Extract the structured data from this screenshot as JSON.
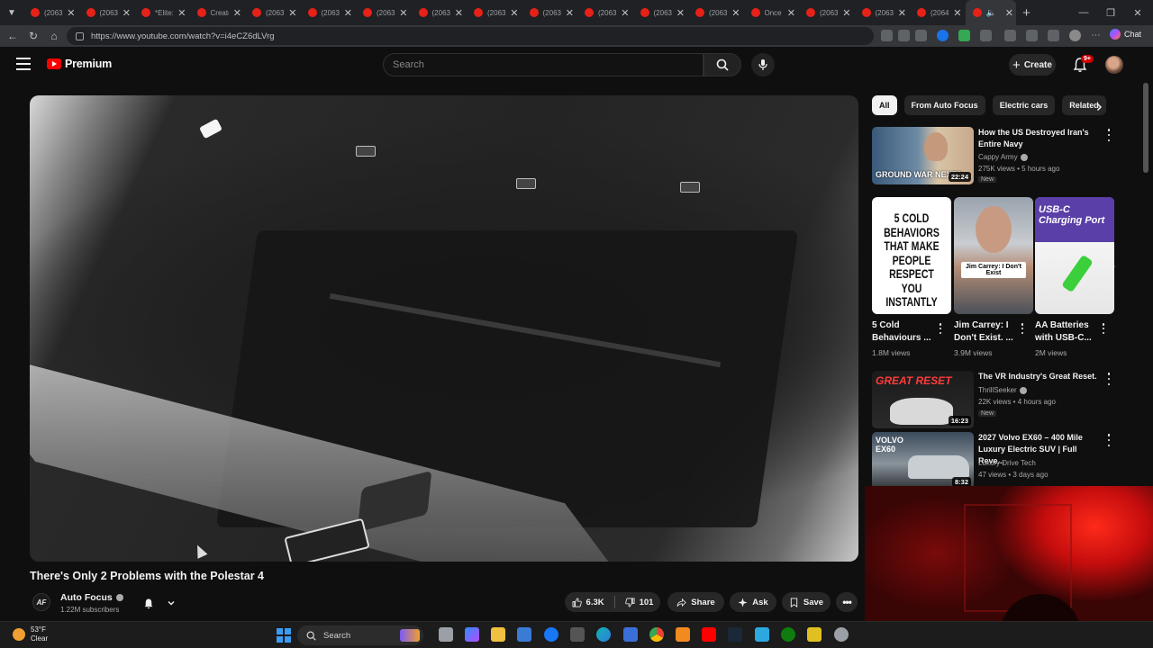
{
  "browser": {
    "tabs": [
      {
        "title": "(2063)"
      },
      {
        "title": "(2063)"
      },
      {
        "title": "*Elite:"
      },
      {
        "title": "Create"
      },
      {
        "title": "(2063)"
      },
      {
        "title": "(2063)"
      },
      {
        "title": "(2063)"
      },
      {
        "title": "(2063)"
      },
      {
        "title": "(2063)"
      },
      {
        "title": "(2063)"
      },
      {
        "title": "(2063)"
      },
      {
        "title": "(2063)"
      },
      {
        "title": "(2063)"
      },
      {
        "title": "Once"
      },
      {
        "title": "(2063)"
      },
      {
        "title": "(2063)"
      },
      {
        "title": "(2064)"
      }
    ],
    "active_tab": {
      "title": "(2"
    },
    "url": "https://www.youtube.com/watch?v=i4eCZ6dLVrg",
    "chat_label": "Chat"
  },
  "header": {
    "brand": "Premium",
    "search_placeholder": "Search",
    "create_label": "Create",
    "notification_count": "9+"
  },
  "video": {
    "title": "There's Only 2 Problems with the Polestar 4",
    "channel": "Auto Focus",
    "channel_initials": "AF",
    "subscribers": "1.22M subscribers",
    "likes": "6.3K",
    "dislikes": "101",
    "share_label": "Share",
    "ask_label": "Ask",
    "save_label": "Save"
  },
  "chips": [
    "All",
    "From Auto Focus",
    "Electric cars",
    "Related"
  ],
  "recommendations": [
    {
      "title": "How the US Destroyed Iran's Entire Navy",
      "channel": "Cappy Army",
      "meta": "275K views • 5 hours ago",
      "badge": "New",
      "duration": "22:24",
      "thumb_text": "GROUND WAR NEXT?"
    },
    {
      "title": "The VR Industry's Great Reset.",
      "channel": "ThrillSeeker",
      "meta": "22K views • 4 hours ago",
      "badge": "New",
      "duration": "16:23",
      "thumb_text": "GREAT RESET"
    },
    {
      "title": "2027 Volvo EX60 – 400 Mile Luxury Electric SUV | Full Reve...",
      "channel": "Luxury Drive Tech",
      "meta": "47 views • 3 days ago",
      "badge": "",
      "duration": "8:32",
      "thumb_text": "VOLVO EX60"
    }
  ],
  "shorts": [
    {
      "title": "5 Cold Behaviours ...",
      "views": "1.8M views",
      "thumb_text": "5 COLD BEHAVIORS THAT MAKE PEOPLE RESPECT YOU INSTANTLY"
    },
    {
      "title": "Jim Carrey: I Don't Exist. ...",
      "views": "3.9M views",
      "thumb_text": "Jim Carrey: I Don't Exist"
    },
    {
      "title": "AA Batteries with USB-C...",
      "views": "2M views",
      "thumb_text": "USB-C Charging Port"
    }
  ],
  "taskbar": {
    "temperature": "53°F",
    "condition": "Clear",
    "search_label": "Search"
  },
  "colors": {
    "background": "#0f0f0f",
    "youtube_red": "#ff0000",
    "chip_active_bg": "#f1f1f1",
    "webcam_red": "#ff2a1a"
  }
}
